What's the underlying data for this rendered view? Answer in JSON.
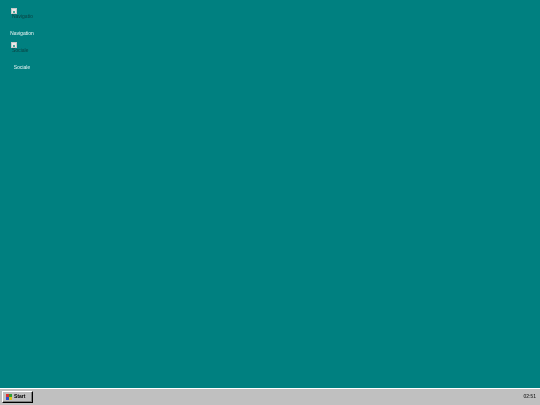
{
  "desktop": {
    "background_color": "#008080",
    "icons": [
      {
        "label": "Navigation",
        "alt": "Navigatio",
        "icon": "broken-image-icon"
      },
      {
        "label": "Sociale",
        "alt": "Sociale",
        "icon": "broken-image-icon"
      }
    ]
  },
  "taskbar": {
    "start_label": "Start",
    "clock": "02:51"
  }
}
